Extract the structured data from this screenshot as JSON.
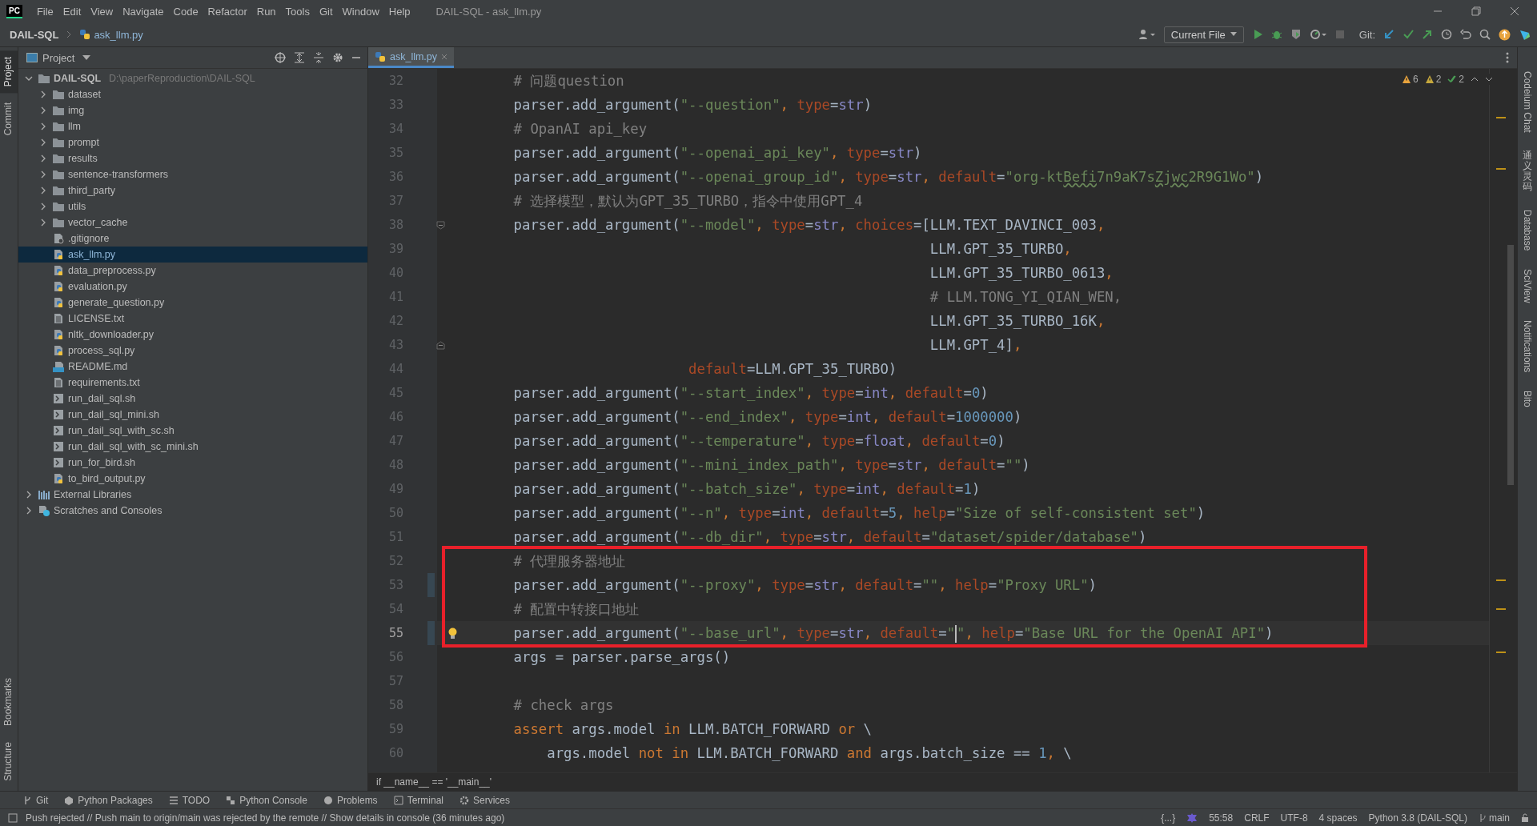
{
  "window": {
    "title": "DAIL-SQL - ask_llm.py",
    "logo": "PC"
  },
  "menu": [
    "File",
    "Edit",
    "View",
    "Navigate",
    "Code",
    "Refactor",
    "Run",
    "Tools",
    "Git",
    "Window",
    "Help"
  ],
  "breadcrumb": [
    "DAIL-SQL",
    "ask_llm.py"
  ],
  "run_config": "Current File",
  "git_label": "Git:",
  "left_tabs": [
    {
      "label": "Project",
      "selected": true
    },
    {
      "label": "Commit",
      "selected": false
    }
  ],
  "left_tabs_bottom": [
    {
      "label": "Bookmarks",
      "selected": false
    },
    {
      "label": "Structure",
      "selected": false
    }
  ],
  "right_tabs": [
    {
      "label": "Codeium Chat",
      "cjk": false
    },
    {
      "label": "通义灵码",
      "cjk": true
    },
    {
      "label": "Database",
      "cjk": false
    },
    {
      "label": "SciView",
      "cjk": false
    },
    {
      "label": "Notifications",
      "cjk": false
    },
    {
      "label": "Bito",
      "cjk": false
    }
  ],
  "project_panel": {
    "title": "Project"
  },
  "tree": [
    {
      "name": "DAIL-SQL",
      "path": "D:\\paperReproduction\\DAIL-SQL",
      "kind": "folder",
      "expanded": true,
      "selected": false,
      "children": [
        {
          "name": "dataset",
          "kind": "folder",
          "expanded": false,
          "selected": false
        },
        {
          "name": "img",
          "kind": "folder",
          "expanded": false,
          "selected": false
        },
        {
          "name": "llm",
          "kind": "folder",
          "expanded": false,
          "selected": false
        },
        {
          "name": "prompt",
          "kind": "folder",
          "expanded": false,
          "selected": false
        },
        {
          "name": "results",
          "kind": "folder",
          "expanded": false,
          "selected": false
        },
        {
          "name": "sentence-transformers",
          "kind": "folder",
          "expanded": false,
          "selected": false
        },
        {
          "name": "third_party",
          "kind": "folder",
          "expanded": false,
          "selected": false
        },
        {
          "name": "utils",
          "kind": "folder",
          "expanded": false,
          "selected": false
        },
        {
          "name": "vector_cache",
          "kind": "folder",
          "expanded": false,
          "selected": false
        },
        {
          "name": ".gitignore",
          "kind": "ignore",
          "selected": false
        },
        {
          "name": "ask_llm.py",
          "kind": "python",
          "selected": true
        },
        {
          "name": "data_preprocess.py",
          "kind": "python",
          "selected": false
        },
        {
          "name": "evaluation.py",
          "kind": "python",
          "selected": false
        },
        {
          "name": "generate_question.py",
          "kind": "python",
          "selected": false
        },
        {
          "name": "LICENSE.txt",
          "kind": "text",
          "selected": false
        },
        {
          "name": "nltk_downloader.py",
          "kind": "python",
          "selected": false
        },
        {
          "name": "process_sql.py",
          "kind": "python",
          "selected": false
        },
        {
          "name": "README.md",
          "kind": "markdown",
          "selected": false
        },
        {
          "name": "requirements.txt",
          "kind": "text",
          "selected": false
        },
        {
          "name": "run_dail_sql.sh",
          "kind": "shell",
          "selected": false
        },
        {
          "name": "run_dail_sql_mini.sh",
          "kind": "shell",
          "selected": false
        },
        {
          "name": "run_dail_sql_with_sc.sh",
          "kind": "shell",
          "selected": false
        },
        {
          "name": "run_dail_sql_with_sc_mini.sh",
          "kind": "shell",
          "selected": false
        },
        {
          "name": "run_for_bird.sh",
          "kind": "shell",
          "selected": false
        },
        {
          "name": "to_bird_output.py",
          "kind": "python",
          "selected": false
        }
      ]
    },
    {
      "name": "External Libraries",
      "kind": "library",
      "expanded": false,
      "selected": false
    },
    {
      "name": "Scratches and Consoles",
      "kind": "scratch",
      "expanded": false,
      "selected": false
    }
  ],
  "editor_tabs": [
    {
      "label": "ask_llm.py",
      "selected": true
    }
  ],
  "inspections": [
    {
      "kind": "warning",
      "count": "6"
    },
    {
      "kind": "weak",
      "count": "2"
    },
    {
      "kind": "ok",
      "count": "2"
    }
  ],
  "lines": [
    {
      "number": "32",
      "tokens": [
        {
          "kind": "comment",
          "text": "    # 问题question"
        }
      ]
    },
    {
      "number": "33",
      "tokens": [
        {
          "kind": "plain",
          "text": "    parser.add_argument("
        },
        {
          "kind": "string",
          "text": "\"--question\""
        },
        {
          "kind": "keyword",
          "text": ", "
        },
        {
          "kind": "param",
          "text": "type"
        },
        {
          "kind": "plain",
          "text": "="
        },
        {
          "kind": "builtin",
          "text": "str"
        },
        {
          "kind": "plain",
          "text": ")"
        }
      ]
    },
    {
      "number": "34",
      "tokens": [
        {
          "kind": "comment",
          "text": "    # OpanAI api_key"
        }
      ]
    },
    {
      "number": "35",
      "tokens": [
        {
          "kind": "plain",
          "text": "    parser.add_argument("
        },
        {
          "kind": "string",
          "text": "\"--openai_api_key\""
        },
        {
          "kind": "keyword",
          "text": ", "
        },
        {
          "kind": "param",
          "text": "type"
        },
        {
          "kind": "plain",
          "text": "="
        },
        {
          "kind": "builtin",
          "text": "str"
        },
        {
          "kind": "plain",
          "text": ")"
        }
      ]
    },
    {
      "number": "36",
      "tokens": [
        {
          "kind": "plain",
          "text": "    parser.add_argument("
        },
        {
          "kind": "string",
          "text": "\"--openai_group_id\""
        },
        {
          "kind": "keyword",
          "text": ", "
        },
        {
          "kind": "param",
          "text": "type"
        },
        {
          "kind": "plain",
          "text": "="
        },
        {
          "kind": "builtin",
          "text": "str"
        },
        {
          "kind": "keyword",
          "text": ", "
        },
        {
          "kind": "param",
          "text": "default"
        },
        {
          "kind": "plain",
          "text": "="
        },
        {
          "kind": "string",
          "text": "\"org-kt"
        },
        {
          "kind": "typo",
          "text": "Befi"
        },
        {
          "kind": "string",
          "text": "7n9aK7s"
        },
        {
          "kind": "typo",
          "text": "Zjwc"
        },
        {
          "kind": "string",
          "text": "2R9G1Wo\""
        },
        {
          "kind": "plain",
          "text": ")"
        }
      ]
    },
    {
      "number": "37",
      "tokens": [
        {
          "kind": "comment",
          "text": "    # 选择模型，默认为GPT_35_TURBO，指令中使用GPT_4"
        }
      ]
    },
    {
      "number": "38",
      "fold_start": true,
      "tokens": [
        {
          "kind": "plain",
          "text": "    parser.add_argument("
        },
        {
          "kind": "string",
          "text": "\"--model\""
        },
        {
          "kind": "keyword",
          "text": ", "
        },
        {
          "kind": "param",
          "text": "type"
        },
        {
          "kind": "plain",
          "text": "="
        },
        {
          "kind": "builtin",
          "text": "str"
        },
        {
          "kind": "keyword",
          "text": ", "
        },
        {
          "kind": "param",
          "text": "choices"
        },
        {
          "kind": "plain",
          "text": "=[LLM.TEXT_DAVINCI_003"
        },
        {
          "kind": "keyword",
          "text": ","
        }
      ]
    },
    {
      "number": "39",
      "tokens": [
        {
          "kind": "plain",
          "text": "                                                      LLM.GPT_35_TURBO"
        },
        {
          "kind": "keyword",
          "text": ","
        }
      ]
    },
    {
      "number": "40",
      "tokens": [
        {
          "kind": "plain",
          "text": "                                                      LLM.GPT_35_TURBO_0613"
        },
        {
          "kind": "keyword",
          "text": ","
        }
      ]
    },
    {
      "number": "41",
      "tokens": [
        {
          "kind": "comment",
          "text": "                                                      # LLM.TONG_YI_QIAN_WEN,"
        }
      ]
    },
    {
      "number": "42",
      "tokens": [
        {
          "kind": "plain",
          "text": "                                                      LLM.GPT_35_TURBO_16K"
        },
        {
          "kind": "keyword",
          "text": ","
        }
      ]
    },
    {
      "number": "43",
      "fold_end": true,
      "tokens": [
        {
          "kind": "plain",
          "text": "                                                      LLM.GPT_4]"
        },
        {
          "kind": "keyword",
          "text": ","
        }
      ]
    },
    {
      "number": "44",
      "tokens": [
        {
          "kind": "param",
          "text": "                         default"
        },
        {
          "kind": "plain",
          "text": "=LLM.GPT_35_TURBO)"
        }
      ]
    },
    {
      "number": "45",
      "tokens": [
        {
          "kind": "plain",
          "text": "    parser.add_argument("
        },
        {
          "kind": "string",
          "text": "\"--start_index\""
        },
        {
          "kind": "keyword",
          "text": ", "
        },
        {
          "kind": "param",
          "text": "type"
        },
        {
          "kind": "plain",
          "text": "="
        },
        {
          "kind": "builtin",
          "text": "int"
        },
        {
          "kind": "keyword",
          "text": ", "
        },
        {
          "kind": "param",
          "text": "default"
        },
        {
          "kind": "plain",
          "text": "="
        },
        {
          "kind": "number",
          "text": "0"
        },
        {
          "kind": "plain",
          "text": ")"
        }
      ]
    },
    {
      "number": "46",
      "tokens": [
        {
          "kind": "plain",
          "text": "    parser.add_argument("
        },
        {
          "kind": "string",
          "text": "\"--end_index\""
        },
        {
          "kind": "keyword",
          "text": ", "
        },
        {
          "kind": "param",
          "text": "type"
        },
        {
          "kind": "plain",
          "text": "="
        },
        {
          "kind": "builtin",
          "text": "int"
        },
        {
          "kind": "keyword",
          "text": ", "
        },
        {
          "kind": "param",
          "text": "default"
        },
        {
          "kind": "plain",
          "text": "="
        },
        {
          "kind": "number",
          "text": "1000000"
        },
        {
          "kind": "plain",
          "text": ")"
        }
      ]
    },
    {
      "number": "47",
      "tokens": [
        {
          "kind": "plain",
          "text": "    parser.add_argument("
        },
        {
          "kind": "string",
          "text": "\"--temperature\""
        },
        {
          "kind": "keyword",
          "text": ", "
        },
        {
          "kind": "param",
          "text": "type"
        },
        {
          "kind": "plain",
          "text": "="
        },
        {
          "kind": "builtin",
          "text": "float"
        },
        {
          "kind": "keyword",
          "text": ", "
        },
        {
          "kind": "param",
          "text": "default"
        },
        {
          "kind": "plain",
          "text": "="
        },
        {
          "kind": "number",
          "text": "0"
        },
        {
          "kind": "plain",
          "text": ")"
        }
      ]
    },
    {
      "number": "48",
      "tokens": [
        {
          "kind": "plain",
          "text": "    parser.add_argument("
        },
        {
          "kind": "string",
          "text": "\"--mini_index_path\""
        },
        {
          "kind": "keyword",
          "text": ", "
        },
        {
          "kind": "param",
          "text": "type"
        },
        {
          "kind": "plain",
          "text": "="
        },
        {
          "kind": "builtin",
          "text": "str"
        },
        {
          "kind": "keyword",
          "text": ", "
        },
        {
          "kind": "param",
          "text": "default"
        },
        {
          "kind": "plain",
          "text": "="
        },
        {
          "kind": "string",
          "text": "\"\""
        },
        {
          "kind": "plain",
          "text": ")"
        }
      ]
    },
    {
      "number": "49",
      "tokens": [
        {
          "kind": "plain",
          "text": "    parser.add_argument("
        },
        {
          "kind": "string",
          "text": "\"--batch_size\""
        },
        {
          "kind": "keyword",
          "text": ", "
        },
        {
          "kind": "param",
          "text": "type"
        },
        {
          "kind": "plain",
          "text": "="
        },
        {
          "kind": "builtin",
          "text": "int"
        },
        {
          "kind": "keyword",
          "text": ", "
        },
        {
          "kind": "param",
          "text": "default"
        },
        {
          "kind": "plain",
          "text": "="
        },
        {
          "kind": "number",
          "text": "1"
        },
        {
          "kind": "plain",
          "text": ")"
        }
      ]
    },
    {
      "number": "50",
      "tokens": [
        {
          "kind": "plain",
          "text": "    parser.add_argument("
        },
        {
          "kind": "string",
          "text": "\"--n\""
        },
        {
          "kind": "keyword",
          "text": ", "
        },
        {
          "kind": "param",
          "text": "type"
        },
        {
          "kind": "plain",
          "text": "="
        },
        {
          "kind": "builtin",
          "text": "int"
        },
        {
          "kind": "keyword",
          "text": ", "
        },
        {
          "kind": "param",
          "text": "default"
        },
        {
          "kind": "plain",
          "text": "="
        },
        {
          "kind": "number",
          "text": "5"
        },
        {
          "kind": "keyword",
          "text": ", "
        },
        {
          "kind": "param",
          "text": "help"
        },
        {
          "kind": "plain",
          "text": "="
        },
        {
          "kind": "string",
          "text": "\"Size of self-consistent set\""
        },
        {
          "kind": "plain",
          "text": ")"
        }
      ]
    },
    {
      "number": "51",
      "tokens": [
        {
          "kind": "plain",
          "text": "    parser.add_argument("
        },
        {
          "kind": "string",
          "text": "\"--db_dir\""
        },
        {
          "kind": "keyword",
          "text": ", "
        },
        {
          "kind": "param",
          "text": "type"
        },
        {
          "kind": "plain",
          "text": "="
        },
        {
          "kind": "builtin",
          "text": "str"
        },
        {
          "kind": "keyword",
          "text": ", "
        },
        {
          "kind": "param",
          "text": "default"
        },
        {
          "kind": "plain",
          "text": "="
        },
        {
          "kind": "string",
          "text": "\"dataset/spider/database\""
        },
        {
          "kind": "plain",
          "text": ")"
        }
      ]
    },
    {
      "number": "52",
      "boxed": true,
      "tokens": [
        {
          "kind": "comment",
          "text": "    # 代理服务器地址"
        }
      ]
    },
    {
      "number": "53",
      "boxed": true,
      "changed": true,
      "tokens": [
        {
          "kind": "plain",
          "text": "    parser.add_argument("
        },
        {
          "kind": "string",
          "text": "\"--proxy\""
        },
        {
          "kind": "keyword",
          "text": ", "
        },
        {
          "kind": "param",
          "text": "type"
        },
        {
          "kind": "plain",
          "text": "="
        },
        {
          "kind": "builtin",
          "text": "str"
        },
        {
          "kind": "keyword",
          "text": ", "
        },
        {
          "kind": "param",
          "text": "default"
        },
        {
          "kind": "plain",
          "text": "="
        },
        {
          "kind": "string",
          "text": "\"\""
        },
        {
          "kind": "keyword",
          "text": ", "
        },
        {
          "kind": "param",
          "text": "help"
        },
        {
          "kind": "plain",
          "text": "="
        },
        {
          "kind": "string",
          "text": "\"Proxy URL\""
        },
        {
          "kind": "plain",
          "text": ")"
        }
      ]
    },
    {
      "number": "54",
      "boxed": true,
      "tokens": [
        {
          "kind": "comment",
          "text": "    # 配置中转接口地址"
        }
      ]
    },
    {
      "number": "55",
      "boxed": true,
      "changed": true,
      "current": true,
      "bulb": true,
      "tokens": [
        {
          "kind": "plain",
          "text": "    parser.add_argument("
        },
        {
          "kind": "string",
          "text": "\"--base_url\""
        },
        {
          "kind": "keyword",
          "text": ", "
        },
        {
          "kind": "param",
          "text": "type"
        },
        {
          "kind": "plain",
          "text": "="
        },
        {
          "kind": "builtin",
          "text": "str"
        },
        {
          "kind": "keyword",
          "text": ", "
        },
        {
          "kind": "param",
          "text": "default"
        },
        {
          "kind": "plain",
          "text": "="
        },
        {
          "kind": "string",
          "text": "\""
        },
        {
          "kind": "caret"
        },
        {
          "kind": "string",
          "text": "\""
        },
        {
          "kind": "keyword",
          "text": ", "
        },
        {
          "kind": "param",
          "text": "help"
        },
        {
          "kind": "plain",
          "text": "="
        },
        {
          "kind": "string",
          "text": "\"Base URL for the OpenAI API\""
        },
        {
          "kind": "plain",
          "text": ")"
        }
      ]
    },
    {
      "number": "56",
      "tokens": [
        {
          "kind": "plain",
          "text": "    args = parser.parse_args()"
        }
      ]
    },
    {
      "number": "57"
    },
    {
      "number": "58",
      "tokens": [
        {
          "kind": "comment",
          "text": "    # check args"
        }
      ]
    },
    {
      "number": "59",
      "tokens": [
        {
          "kind": "keyword",
          "text": "    assert"
        },
        {
          "kind": "plain",
          "text": " args.model "
        },
        {
          "kind": "keyword",
          "text": "in"
        },
        {
          "kind": "plain",
          "text": " LLM.BATCH_FORWARD "
        },
        {
          "kind": "keyword",
          "text": "or"
        },
        {
          "kind": "plain",
          "text": " \\"
        }
      ]
    },
    {
      "number": "60",
      "tokens": [
        {
          "kind": "plain",
          "text": "        args.model "
        },
        {
          "kind": "keyword",
          "text": "not in"
        },
        {
          "kind": "plain",
          "text": " LLM.BATCH_FORWARD "
        },
        {
          "kind": "keyword",
          "text": "and"
        },
        {
          "kind": "plain",
          "text": " args.batch_size == "
        },
        {
          "kind": "number",
          "text": "1"
        },
        {
          "kind": "keyword",
          "text": ","
        },
        {
          "kind": "plain",
          "text": " \\"
        }
      ]
    }
  ],
  "editor_breadcrumb": "if __name__ == '__main__'",
  "tool_tabs": [
    "Git",
    "Python Packages",
    "TODO",
    "Python Console",
    "Problems",
    "Terminal",
    "Services"
  ],
  "status": {
    "message": "Push rejected // Push main to origin/main was rejected by the remote // Show details in console (36 minutes ago)",
    "braces": "{...}",
    "position": "55:58",
    "line_sep": "CRLF",
    "encoding": "UTF-8",
    "indent": "4 spaces",
    "interpreter": "Python 3.8 (DAIL-SQL)",
    "branch": "main"
  }
}
